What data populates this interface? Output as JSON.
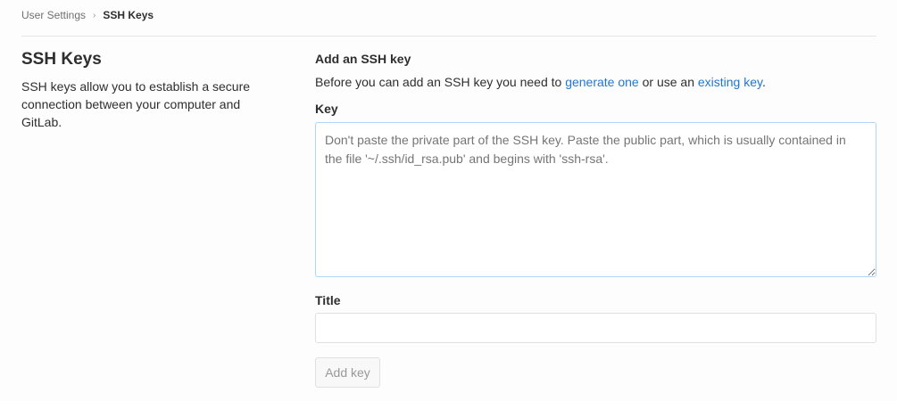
{
  "breadcrumb": {
    "parent": "User Settings",
    "separator": "›",
    "current": "SSH Keys"
  },
  "left": {
    "title": "SSH Keys",
    "description": "SSH keys allow you to establish a secure connection between your computer and GitLab."
  },
  "form": {
    "heading": "Add an SSH key",
    "intro_before": "Before you can add an SSH key you need to ",
    "link_generate": "generate one",
    "intro_middle": " or use an ",
    "link_existing": "existing key",
    "intro_after": ".",
    "key_label": "Key",
    "key_placeholder": "Don't paste the private part of the SSH key. Paste the public part, which is usually contained in the file '~/.ssh/id_rsa.pub' and begins with 'ssh-rsa'.",
    "title_label": "Title",
    "title_value": "",
    "submit_label": "Add key"
  }
}
